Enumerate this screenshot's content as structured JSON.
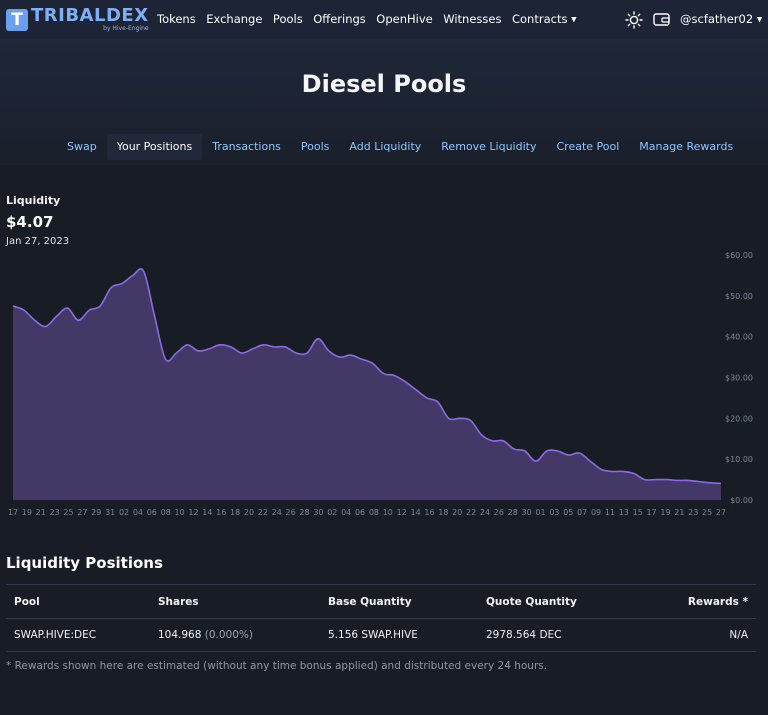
{
  "nav": {
    "logo_letter": "T",
    "logo_name": "TRIBALDEX",
    "logo_sub": "by Hive-Engine",
    "links": [
      "Tokens",
      "Exchange",
      "Pools",
      "Offerings",
      "OpenHive",
      "Witnesses",
      "Contracts"
    ],
    "user": "@scfather02",
    "icons": [
      "sun-icon",
      "wallet-icon",
      "chevron-down-icon"
    ]
  },
  "page": {
    "title": "Diesel Pools"
  },
  "tabs": [
    "Swap",
    "Your Positions",
    "Transactions",
    "Pools",
    "Add Liquidity",
    "Remove Liquidity",
    "Create Pool",
    "Manage Rewards"
  ],
  "active_tab": "Your Positions",
  "summary": {
    "label": "Liquidity",
    "value": "$4.07",
    "date": "Jan 27, 2023"
  },
  "chart_data": {
    "type": "area",
    "title": "",
    "xlabel": "",
    "ylabel": "",
    "ylim": [
      0,
      60
    ],
    "y_ticks": [
      "$0.00",
      "$10.00",
      "$20.00",
      "$30.00",
      "$40.00",
      "$50.00",
      "$60.00"
    ],
    "x_ticks": [
      "17",
      "19",
      "21",
      "23",
      "25",
      "27",
      "29",
      "31",
      "02",
      "04",
      "06",
      "08",
      "10",
      "12",
      "14",
      "16",
      "18",
      "20",
      "22",
      "24",
      "26",
      "28",
      "30",
      "02",
      "04",
      "06",
      "08",
      "10",
      "12",
      "14",
      "16",
      "18",
      "20",
      "22",
      "24",
      "26",
      "28",
      "30",
      "01",
      "03",
      "05",
      "07",
      "09",
      "11",
      "13",
      "15",
      "17",
      "19",
      "21",
      "23",
      "25",
      "27"
    ],
    "series": [
      {
        "values": [
          47.5,
          46.5,
          44,
          42.5,
          45,
          47,
          44,
          46.5,
          47.5,
          52,
          53,
          55,
          56,
          45,
          34.5,
          36,
          38,
          36.5,
          37,
          38,
          37.5,
          36,
          37,
          38,
          37.5,
          37.5,
          36,
          36,
          39.5,
          36.5,
          35,
          35.5,
          34.5,
          33.5,
          31,
          30.5,
          29,
          27,
          25,
          24,
          20,
          20,
          19.5,
          16,
          14.5,
          14.5,
          12.5,
          12,
          9.5,
          12,
          12,
          11,
          11.5,
          9.5,
          7.5,
          7,
          7,
          6.5,
          5,
          5,
          5,
          4.8,
          4.8,
          4.5,
          4.2,
          4.07
        ],
        "color": "#8b6ae8"
      }
    ],
    "fill_color": "#443966",
    "grid": false
  },
  "positions": {
    "title": "Liquidity Positions",
    "columns": [
      "Pool",
      "Shares",
      "Base Quantity",
      "Quote Quantity",
      "Rewards *"
    ],
    "rows": [
      {
        "pool": "SWAP.HIVE:DEC",
        "shares": "104.968",
        "shares_pct": "(0.000%)",
        "base": "5.156 SWAP.HIVE",
        "quote": "2978.564 DEC",
        "rewards": "N/A"
      }
    ]
  },
  "footnote": "* Rewards shown here are estimated (without any time bonus applied) and distributed every 24 hours."
}
